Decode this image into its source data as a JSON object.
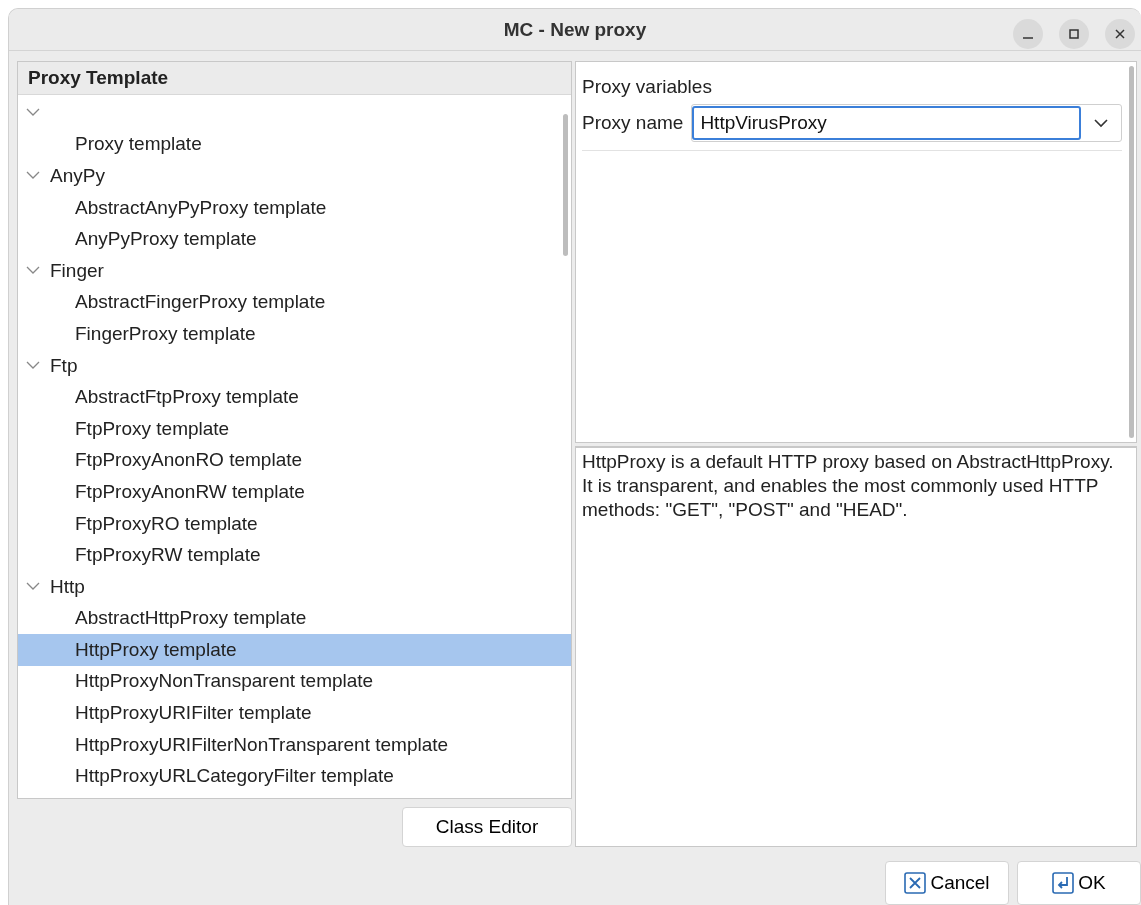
{
  "window": {
    "title": "MC - New proxy"
  },
  "tree": {
    "header": "Proxy Template",
    "groups": [
      {
        "expanded": true,
        "children": [
          {
            "label": "Proxy template",
            "selected": false
          }
        ]
      },
      {
        "label": "AnyPy",
        "expanded": true,
        "children": [
          {
            "label": "AbstractAnyPyProxy template",
            "selected": false
          },
          {
            "label": "AnyPyProxy template",
            "selected": false
          }
        ]
      },
      {
        "label": "Finger",
        "expanded": true,
        "children": [
          {
            "label": "AbstractFingerProxy template",
            "selected": false
          },
          {
            "label": "FingerProxy template",
            "selected": false
          }
        ]
      },
      {
        "label": "Ftp",
        "expanded": true,
        "children": [
          {
            "label": "AbstractFtpProxy template",
            "selected": false
          },
          {
            "label": "FtpProxy template",
            "selected": false
          },
          {
            "label": "FtpProxyAnonRO template",
            "selected": false
          },
          {
            "label": "FtpProxyAnonRW template",
            "selected": false
          },
          {
            "label": "FtpProxyRO template",
            "selected": false
          },
          {
            "label": "FtpProxyRW template",
            "selected": false
          }
        ]
      },
      {
        "label": "Http",
        "expanded": true,
        "children": [
          {
            "label": "AbstractHttpProxy template",
            "selected": false
          },
          {
            "label": "HttpProxy template",
            "selected": true
          },
          {
            "label": "HttpProxyNonTransparent template",
            "selected": false
          },
          {
            "label": "HttpProxyURIFilter template",
            "selected": false
          },
          {
            "label": "HttpProxyURIFilterNonTransparent template",
            "selected": false
          },
          {
            "label": "HttpProxyURLCategoryFilter template",
            "selected": false
          }
        ]
      }
    ]
  },
  "class_editor_button": "Class Editor",
  "variables": {
    "title": "Proxy variables",
    "label": "Proxy name",
    "value": "HttpVirusProxy"
  },
  "description": "HttpProxy is a default HTTP proxy based on AbstractHttpProxy. It is transparent, and enables the most commonly used HTTP methods: \"GET\", \"POST\" and \"HEAD\".",
  "buttons": [
    {
      "kind": "cancel",
      "label": "Cancel"
    },
    {
      "kind": "ok",
      "label": "OK"
    }
  ]
}
